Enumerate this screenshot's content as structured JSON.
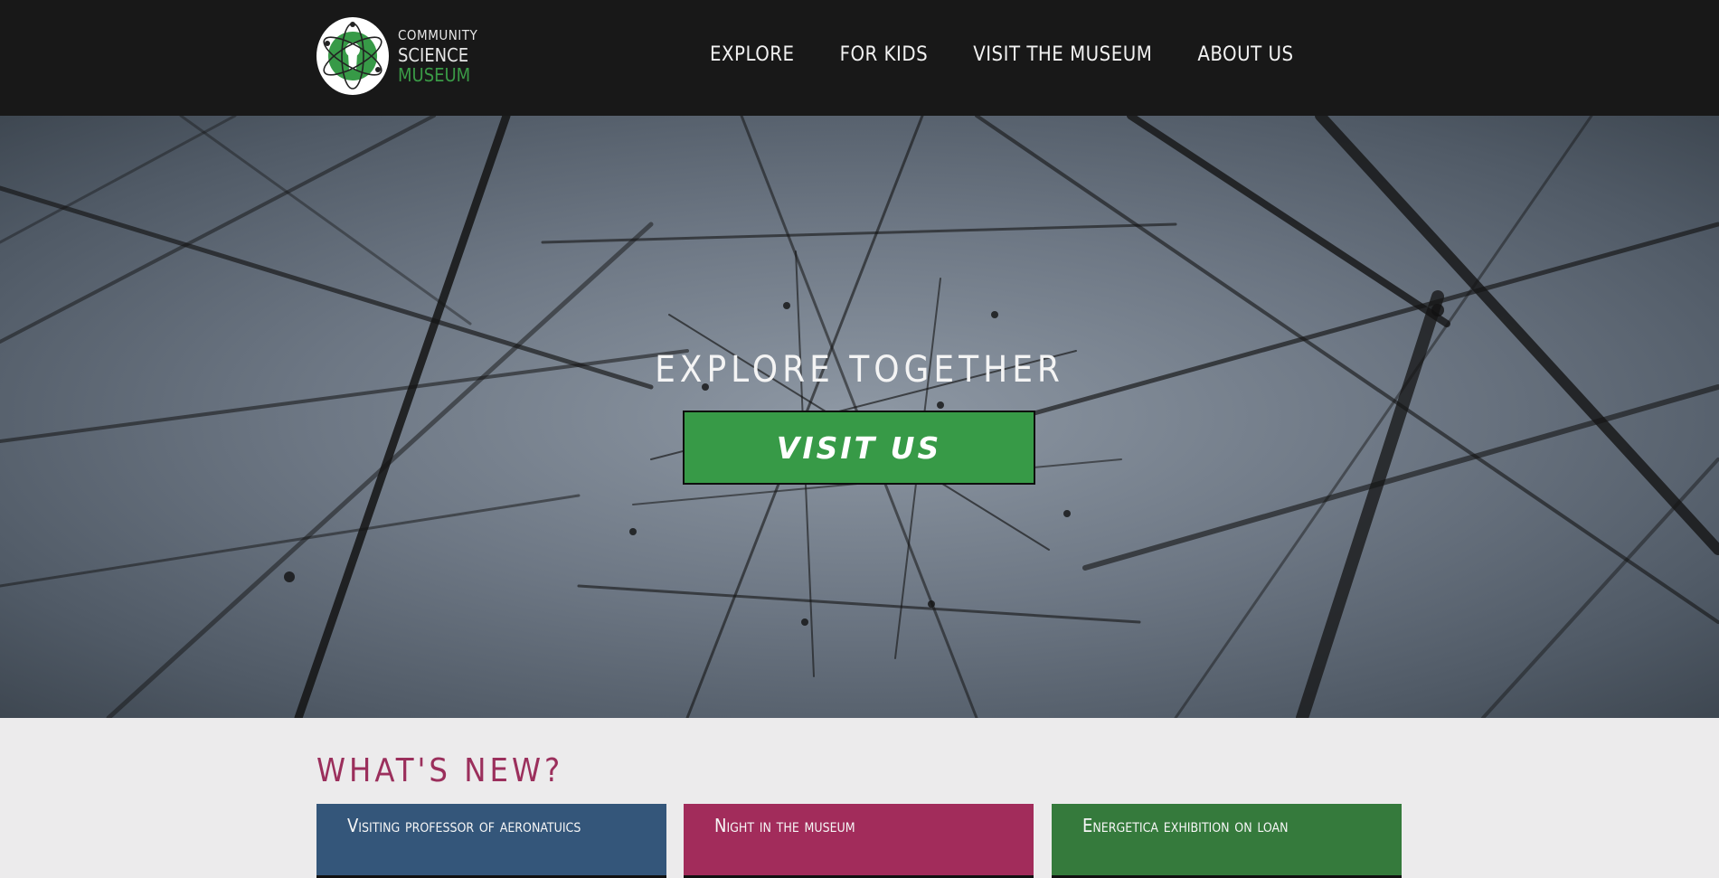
{
  "logo": {
    "line1": "COMMUNITY",
    "line2": "SCIENCE",
    "line3": "MUSEUM"
  },
  "nav": {
    "items": [
      "EXPLORE",
      "FOR KIDS",
      "VISIT THE MUSEUM",
      "ABOUT US"
    ]
  },
  "hero": {
    "title": "EXPLORE TOGETHER",
    "button_label": "VISIT US"
  },
  "whats_new": {
    "heading": "WHAT'S NEW?",
    "cards": [
      {
        "title": "Visiting professor of aeronatuics"
      },
      {
        "title": "Night in the museum"
      },
      {
        "title": "Energetica exhibition on loan"
      }
    ]
  },
  "colors": {
    "header_bg": "#181818",
    "accent_green": "#379a47",
    "heading_magenta": "#9b2f5c",
    "card_blue": "#34567a",
    "card_magenta": "#a22c5b",
    "card_green": "#357a3c"
  },
  "icons": {
    "logo": "atom-keyhole-icon"
  }
}
